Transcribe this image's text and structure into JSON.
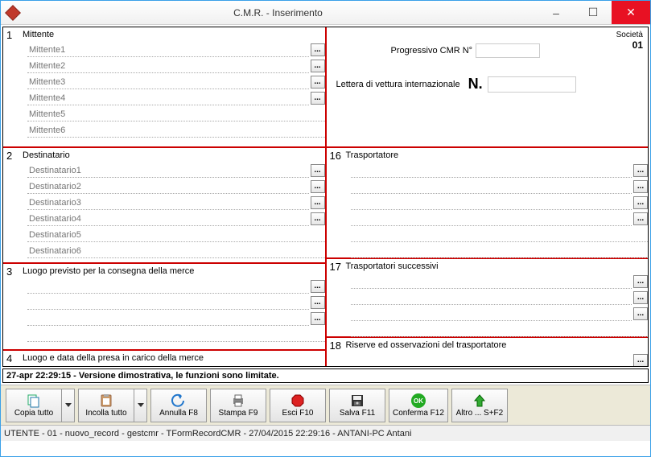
{
  "window": {
    "title": "C.M.R.  -  Inserimento",
    "minimize": "–",
    "maximize": "☐",
    "close": "✕"
  },
  "left": {
    "box1": {
      "num": "1",
      "title": "Mittente",
      "fields": [
        "Mittente1",
        "Mittente2",
        "Mittente3",
        "Mittente4",
        "Mittente5",
        "Mittente6"
      ]
    },
    "box2": {
      "num": "2",
      "title": "Destinatario",
      "fields": [
        "Destinatario1",
        "Destinatario2",
        "Destinatario3",
        "Destinatario4",
        "Destinatario5",
        "Destinatario6"
      ]
    },
    "box3": {
      "num": "3",
      "title": "Luogo previsto per la consegna della merce"
    },
    "box4": {
      "num": "4",
      "title": "Luogo e data della presa in carico della merce"
    }
  },
  "right": {
    "societa_label": "Società",
    "societa_val": "01",
    "prog_label": "Progressivo CMR  N°",
    "lettera_label": "Lettera di vettura internazionale",
    "n_label": "N.",
    "box16": {
      "num": "16",
      "title": "Trasportatore"
    },
    "box17": {
      "num": "17",
      "title": "Trasportatori successivi"
    },
    "box18": {
      "num": "18",
      "title": "Riserve ed osservazioni del trasportatore"
    }
  },
  "ellipsis": "...",
  "demo_msg": "27-apr 22:29:15 - Versione dimostrativa, le funzioni sono limitate.",
  "toolbar": {
    "copia": "Copia tutto",
    "incolla": "Incolla tutto",
    "annulla": "Annulla  F8",
    "stampa": "Stampa  F9",
    "esci": "Esci   F10",
    "salva": "Salva  F11",
    "conferma": "Conferma  F12",
    "altro": "Altro ... S+F2"
  },
  "statusbar": "UTENTE - 01 - nuovo_record - gestcmr - TFormRecordCMR - 27/04/2015 22:29:16 - ANTANI-PC  Antani"
}
